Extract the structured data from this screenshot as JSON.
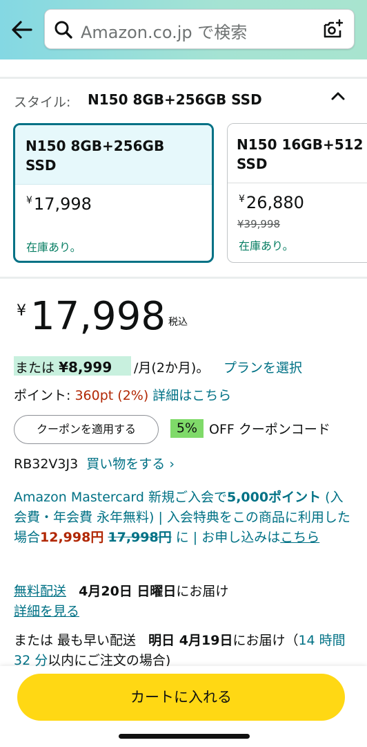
{
  "header": {
    "search_placeholder": "Amazon.co.jp で検索"
  },
  "style_selector": {
    "label": "スタイル:",
    "selected_value": "N150 8GB+256GB SSD",
    "options": [
      {
        "name": "N150 8GB+256GB\nSSD",
        "price_symbol": "¥",
        "price": "17,998",
        "was_price": "",
        "stock": "在庫あり。",
        "selected": true
      },
      {
        "name": "N150 16GB+512\nSSD",
        "price_symbol": "¥",
        "price": "26,880",
        "was_price": "¥39,998",
        "stock": "在庫あり。",
        "selected": false
      }
    ]
  },
  "price": {
    "symbol": "¥",
    "amount": "17,998",
    "tax_note": "税込"
  },
  "installment": {
    "prefix": "または",
    "amount": "¥8,999",
    "period": "/月(2か月)。",
    "plan_link": "プランを選択"
  },
  "points": {
    "label": "ポイント:",
    "value": "360pt",
    "percent": "(2%)",
    "link": "詳細はこちら"
  },
  "coupon": {
    "button": "クーポンを適用する",
    "badge": "5%",
    "off_text": "OFF クーポンコード",
    "code": "RB32V3J3",
    "shop_link": "買い物をする ›"
  },
  "mastercard": {
    "part1": "Amazon Mastercard 新規ご入会で",
    "points_bold": "5,000ポイント",
    "part2": " (入会費・年会費 永年無料) | 入会特典をこの商品に利用した場合",
    "discounted": "12,998円",
    "original": "17,998円",
    "part3": " に | お申し込みは",
    "link": "こちら"
  },
  "shipping": {
    "free_link": "無料配送",
    "date": "4月20日 日曜日",
    "suffix": "にお届け",
    "details_link": "詳細を見る"
  },
  "fastest": {
    "prefix": "または 最も早い配送",
    "date": "明日 4月19日",
    "middle": "にお届け（",
    "countdown": "14 時間 32 分",
    "suffix": "以内にご注文の場合)"
  },
  "cart": {
    "button": "カートに入れる"
  }
}
